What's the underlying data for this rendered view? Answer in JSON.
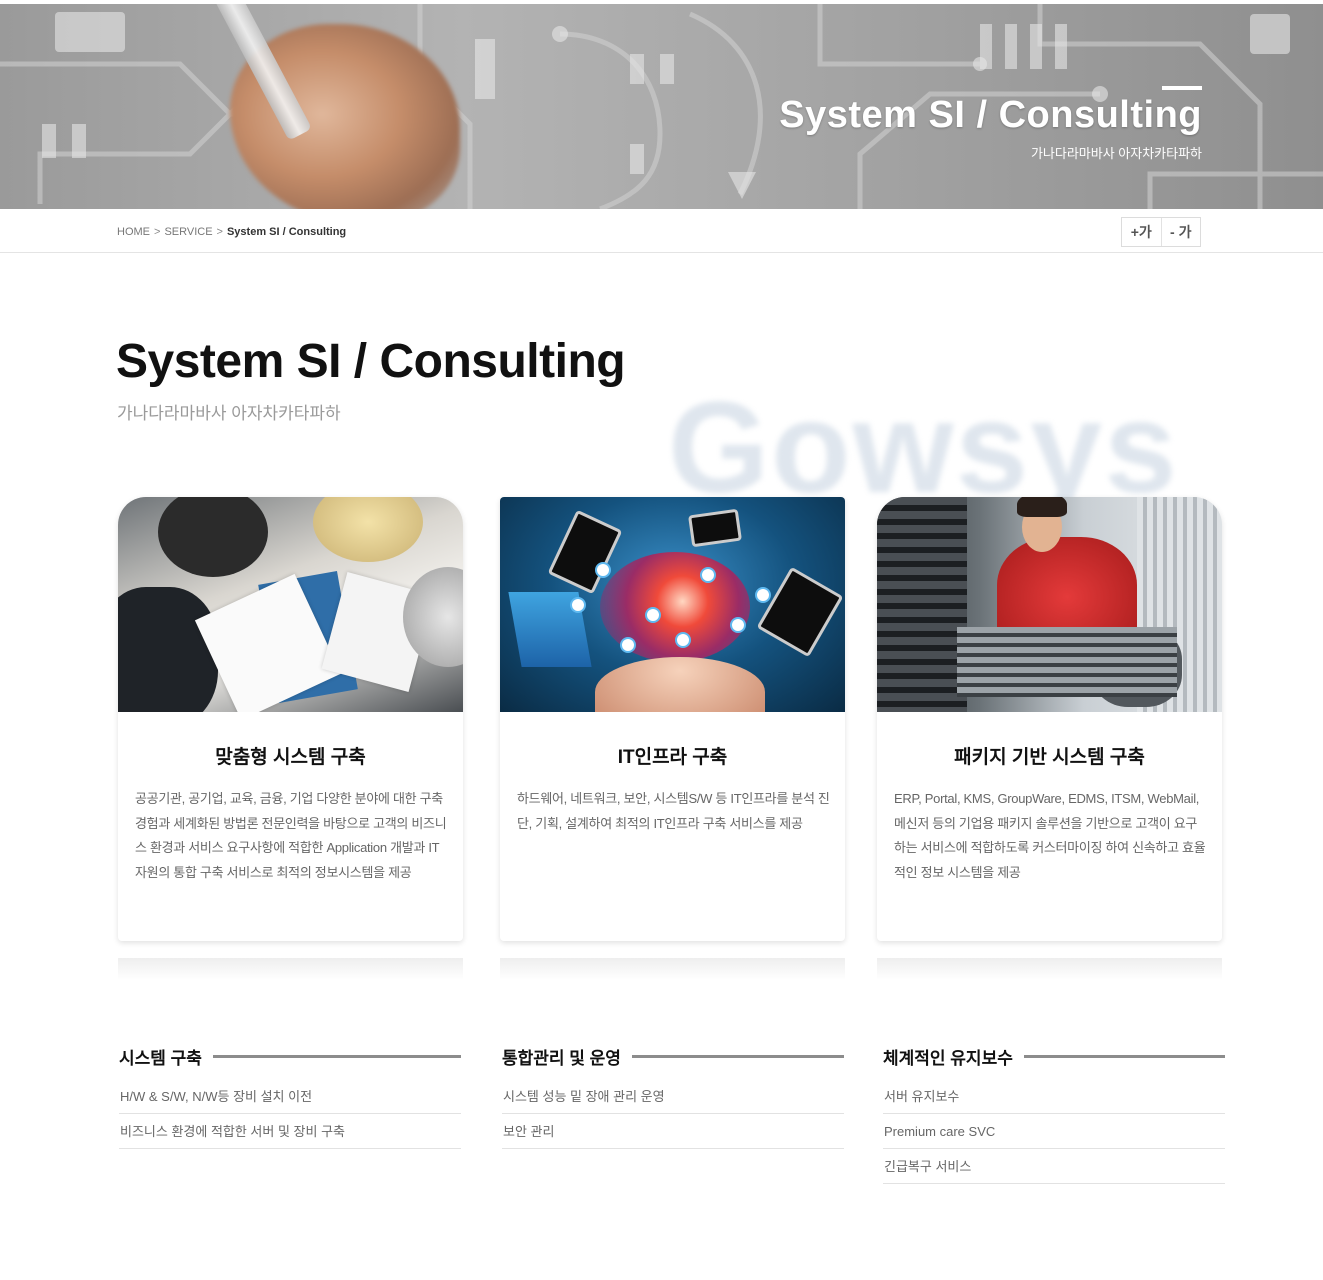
{
  "hero": {
    "title": "System SI / Consulting",
    "subtitle": "가나다라마바사 아자차카타파하"
  },
  "breadcrumb": {
    "home": "HOME",
    "separator": ">",
    "section": "SERVICE",
    "current": "System SI / Consulting"
  },
  "font_controls": {
    "increase": "+가",
    "decrease": "- 가"
  },
  "page": {
    "title": "System SI / Consulting",
    "subtitle": "가나다라마바사 아자차카타파하",
    "watermark": "Gowsys"
  },
  "cards": [
    {
      "title": "맞춤형 시스템 구축",
      "description": "공공기관, 공기업, 교육, 금융, 기업 다양한 분야에 대한 구축 경험과 세계화된 방법론 전문인력을 바탕으로 고객의 비즈니스 환경과 서비스 요구사항에 적합한 Application 개발과 IT자원의 통합 구축 서비스로 최적의 정보시스템을 제공"
    },
    {
      "title": "IT인프라 구축",
      "description": "하드웨어, 네트워크, 보안, 시스템S/W 등 IT인프라를 분석 진단, 기획, 설계하여 최적의 IT인프라 구축 서비스를 제공"
    },
    {
      "title": "패키지 기반 시스템 구축",
      "description": "ERP, Portal, KMS, GroupWare, EDMS, ITSM, WebMail, 메신저 등의 기업용 패키지 솔루션을 기반으로 고객이 요구하는 서비스에 적합하도록 커스터마이징 하여 신속하고 효율적인 정보 시스템을 제공"
    }
  ],
  "columns": [
    {
      "title": "시스템 구축",
      "items": [
        "H/W & S/W, N/W등 장비 설치 이전",
        "비즈니스 환경에 적합한 서버 및 장비 구축"
      ]
    },
    {
      "title": "통합관리 및 운영",
      "items": [
        "시스템 성능 밑 장애 관리 운영",
        "보안 관리"
      ]
    },
    {
      "title": "체계적인 유지보수",
      "items": [
        "서버 유지보수",
        "Premium care SVC",
        "긴급복구 서비스"
      ]
    }
  ]
}
